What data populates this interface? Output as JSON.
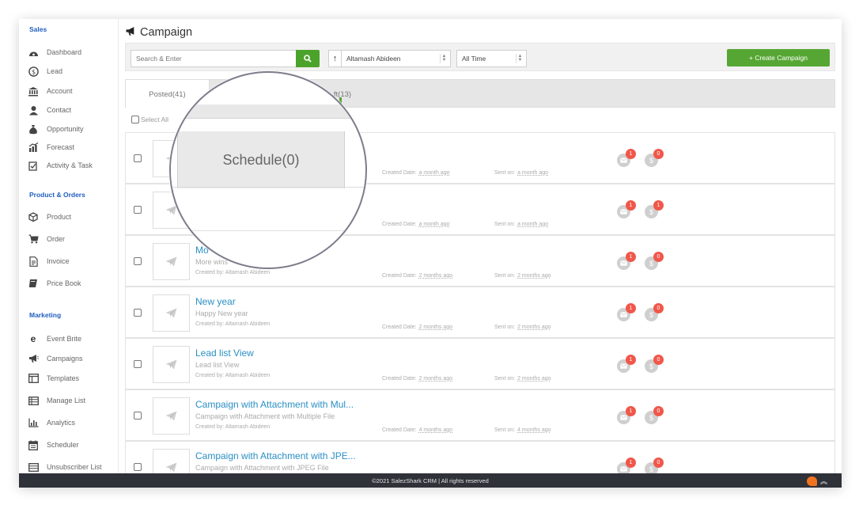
{
  "sidebar": {
    "sections": [
      {
        "title": "Sales",
        "items": [
          {
            "label": "Dashboard",
            "icon": "dashboard-icon"
          },
          {
            "label": "Lead",
            "icon": "dollar-icon"
          },
          {
            "label": "Account",
            "icon": "bank-icon"
          },
          {
            "label": "Contact",
            "icon": "contact-icon"
          },
          {
            "label": "Opportunity",
            "icon": "money-bag-icon"
          },
          {
            "label": "Forecast",
            "icon": "chart-icon"
          },
          {
            "label": "Activity & Task",
            "icon": "task-icon"
          }
        ]
      },
      {
        "title": "Product & Orders",
        "items": [
          {
            "label": "Product",
            "icon": "box-icon"
          },
          {
            "label": "Order",
            "icon": "cart-icon"
          },
          {
            "label": "Invoice",
            "icon": "invoice-icon"
          },
          {
            "label": "Price Book",
            "icon": "book-icon"
          }
        ]
      },
      {
        "title": "Marketing",
        "items": [
          {
            "label": "Event Brite",
            "icon": "eventbrite-icon"
          },
          {
            "label": "Campaigns",
            "icon": "megaphone-icon"
          },
          {
            "label": "Templates",
            "icon": "template-icon"
          },
          {
            "label": "Manage List",
            "icon": "list-icon"
          },
          {
            "label": "Analytics",
            "icon": "analytics-icon"
          },
          {
            "label": "Scheduler",
            "icon": "calendar-icon"
          },
          {
            "label": "Unsubscriber List",
            "icon": "unsubscribe-icon"
          }
        ]
      }
    ]
  },
  "header": {
    "title": "Campaign",
    "icon": "megaphone-icon"
  },
  "toolbar": {
    "search_placeholder": "Search & Enter",
    "sort_label": "↑",
    "owner_select": "Altamash Abideen",
    "period_select": "All Time",
    "create_label": "+ Create Campaign"
  },
  "tabs": [
    {
      "label": "Posted(41)"
    },
    {
      "label": "ft(13)"
    }
  ],
  "select_all_label": "Select All",
  "meta_labels": {
    "created": "Created Date:",
    "sent": "Sent on:"
  },
  "campaigns": [
    {
      "title": "",
      "desc": "",
      "creator": "",
      "created": "a month ago",
      "sent": "a month ago",
      "email_count": "1",
      "deal_count": "0"
    },
    {
      "title": "",
      "desc": "",
      "creator": "",
      "created": "a month ago",
      "sent": "a month ago",
      "email_count": "1",
      "deal_count": "1"
    },
    {
      "title": "Mo",
      "desc": "More wins",
      "creator": "Created by: Altamash Abideen",
      "created": "2 months ago",
      "sent": "2 months ago",
      "email_count": "1",
      "deal_count": "0"
    },
    {
      "title": "New year",
      "desc": "Happy New year",
      "creator": "Created by: Altamash Abideen",
      "created": "2 months ago",
      "sent": "2 months ago",
      "email_count": "1",
      "deal_count": "0"
    },
    {
      "title": "Lead list View",
      "desc": "Lead list View",
      "creator": "Created by: Altamash Abideen",
      "created": "2 months ago",
      "sent": "2 months ago",
      "email_count": "1",
      "deal_count": "0"
    },
    {
      "title": "Campaign with Attachment with Mul...",
      "desc": "Campaign with Attachment with Multiple File",
      "creator": "Created by: Altamash Abideen",
      "created": "4 months ago",
      "sent": "4 months ago",
      "email_count": "1",
      "deal_count": "0"
    },
    {
      "title": "Campaign with Attachment with JPE...",
      "desc": "Campaign with Attachment with JPEG File",
      "creator": "",
      "created": "",
      "sent": "",
      "email_count": "1",
      "deal_count": "0"
    }
  ],
  "magnifier": {
    "label": "Schedule(0)"
  },
  "footer": {
    "text": "©2021 SalezShark CRM | All rights reserved"
  },
  "colors": {
    "accent_green": "#56a634",
    "link_blue": "#2a8fc4",
    "section_blue": "#1f5fbf",
    "badge_red": "#f0574a",
    "footer_bg": "#2f3239"
  }
}
